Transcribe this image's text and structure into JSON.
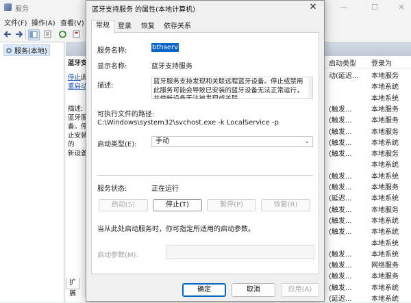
{
  "bg_window": {
    "title": "服务",
    "menu": [
      "文件(F)",
      "操作(A)",
      "查看(V)"
    ],
    "tree_item": "服务(本地)",
    "left_pane": {
      "title": "蓝牙支",
      "link1_prefix": "停止",
      "link1_suffix": "此",
      "link2": "重启动",
      "desc_label": "描述:",
      "desc_lines": [
        "蓝牙服",
        "备。停",
        "止安装的",
        "新设备"
      ]
    },
    "bottom_tab": "扩展",
    "table": {
      "headers": [
        "启动类型",
        "登录为"
      ],
      "rows": [
        [
          "动(延迟...",
          "本地服务"
        ],
        [
          "",
          "本地系统"
        ],
        [
          "",
          "本地系统"
        ],
        [
          "(触发...",
          "本地服务"
        ],
        [
          "(触发...",
          "本地服务"
        ],
        [
          "(触发...",
          "本地服务"
        ],
        [
          "(触发...",
          "本地系统"
        ],
        [
          "(触发...",
          "本地服务"
        ],
        [
          "",
          "本地系统"
        ],
        [
          "(触发...",
          "本地系统"
        ],
        [
          "(触发...",
          "本地服务"
        ],
        [
          "(延迟...",
          "本地系统"
        ],
        [
          "(触发...",
          "本地服务"
        ],
        [
          "(触发...",
          "本地系统"
        ],
        [
          "(触发...",
          "本地系统"
        ],
        [
          "",
          "本地系统"
        ],
        [
          "(触发...",
          "本地系统"
        ],
        [
          "(触发...",
          "网络服务"
        ],
        [
          "(触发...",
          "本地服务"
        ],
        [
          "(触发...",
          "本地系统"
        ],
        [
          "(延迟...",
          "本地系统"
        ]
      ]
    }
  },
  "dialog": {
    "title": "蓝牙支持服务 的属性(本地计算机)",
    "close_glyph": "✕",
    "tabs": [
      "常规",
      "登录",
      "恢复",
      "依存关系"
    ],
    "service_name_label": "服务名称:",
    "service_name_value": "bthserv",
    "display_name_label": "显示名称:",
    "display_name_value": "蓝牙支持服务",
    "desc_label": "描述:",
    "desc_text": "蓝牙服务支持发现和关联远程蓝牙设备。停止或禁用此服务可能会导致已安装的蓝牙设备无法正常运行，并使新设备无法被发现或关联。",
    "path_label": "可执行文件的路径:",
    "path_value": "C:\\Windows\\system32\\svchost.exe -k LocalService -p",
    "startup_type_label": "启动类型(E):",
    "startup_type_value": "手动",
    "status_label": "服务状态:",
    "status_value": "正在运行",
    "buttons": {
      "start": "启动(S)",
      "stop": "停止(T)",
      "pause": "暂停(P)",
      "resume": "恢复(R)"
    },
    "hint": "当从此处启动服务时，你可指定所适用的启动参数。",
    "param_label": "启动参数(M):",
    "param_value": "",
    "footer": {
      "ok": "确定",
      "cancel": "取消",
      "apply": "应用(A)"
    }
  }
}
